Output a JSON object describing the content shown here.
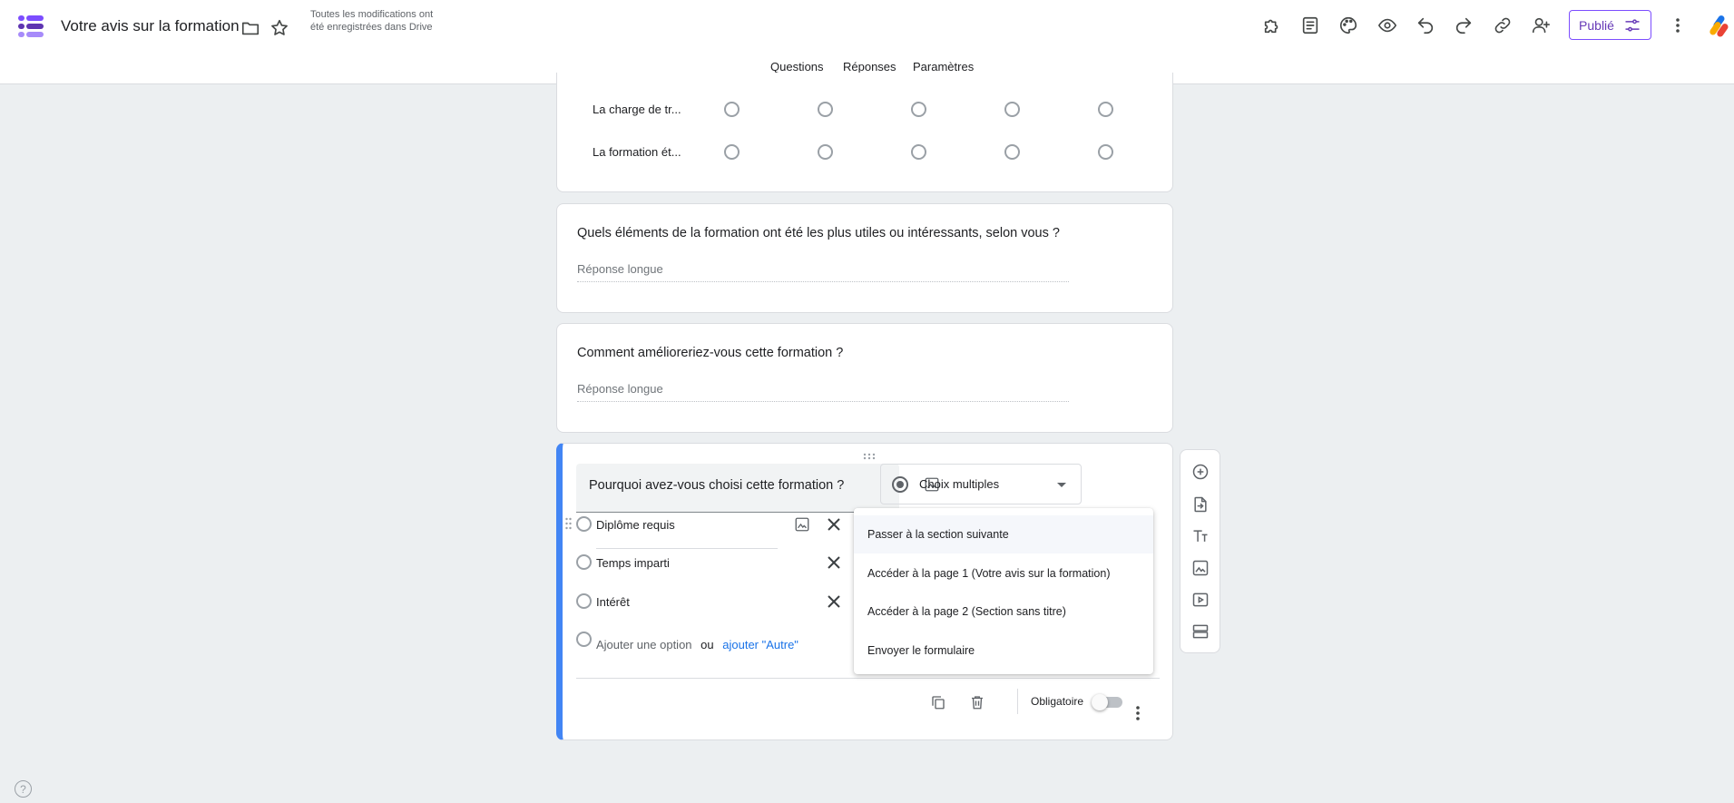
{
  "header": {
    "title": "Votre avis sur la formation",
    "save_status": "Toutes les modifications ont été enregistrées dans Drive",
    "publish_label": "Publié",
    "icons": [
      "folder-icon",
      "star-icon",
      "addon-icon",
      "template-icon",
      "palette-icon",
      "preview-icon",
      "undo-icon",
      "redo-icon",
      "link-icon",
      "add-collaborator-icon",
      "more-icon"
    ]
  },
  "tabs": [
    {
      "label": "Questions",
      "active": true
    },
    {
      "label": "Réponses",
      "active": false
    },
    {
      "label": "Paramètres",
      "active": false
    }
  ],
  "grid_card": {
    "rows": [
      "La charge de tr...",
      "La formation ét..."
    ],
    "columns_count": 5
  },
  "questions": [
    {
      "title": "Quels éléments de la formation ont été les plus utiles ou intéressants, selon vous ?",
      "placeholder": "Réponse longue"
    },
    {
      "title": "Comment amélioreriez-vous cette formation ?",
      "placeholder": "Réponse longue"
    }
  ],
  "active_question": {
    "title": "Pourquoi avez-vous choisi cette formation ?",
    "type": "Choix multiples",
    "options": [
      "Diplôme requis",
      "Temps imparti",
      "Intérêt"
    ],
    "add_option": "Ajouter une option",
    "or": "ou",
    "add_other": "ajouter \"Autre\"",
    "required_label": "Obligatoire",
    "required": false
  },
  "section_menu": {
    "items": [
      "Passer à la section suivante",
      "Accéder à la page 1 (Votre avis sur la formation)",
      "Accéder à la page 2 (Section sans titre)",
      "Envoyer le formulaire"
    ],
    "highlighted_index": 0
  },
  "side_toolbar": [
    "add-question-icon",
    "import-questions-icon",
    "add-title-icon",
    "add-image-icon",
    "add-video-icon",
    "add-section-icon"
  ],
  "help_glyph": "?",
  "colors": {
    "accent": "#673ab7",
    "active_border": "#4285f4",
    "link": "#1a73e8"
  }
}
